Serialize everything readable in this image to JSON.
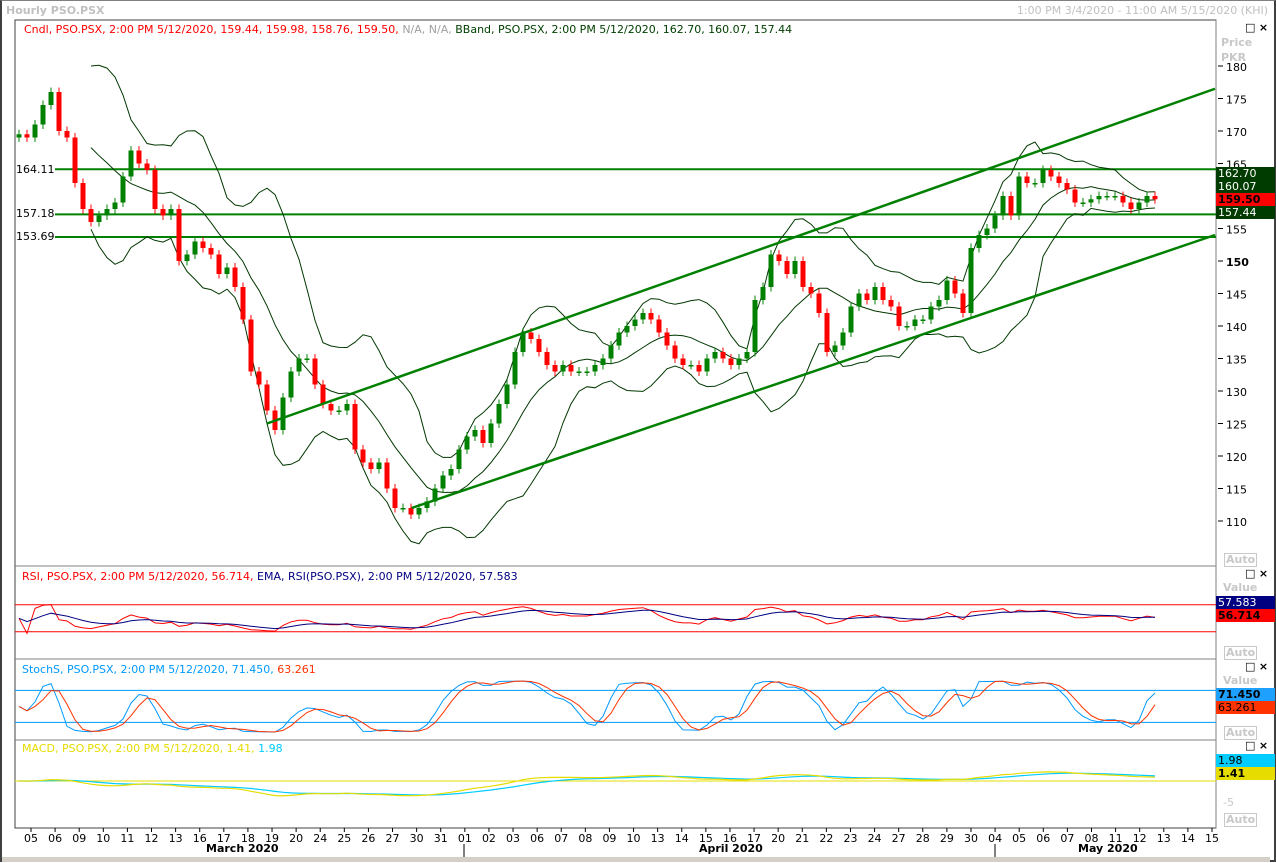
{
  "window": {
    "title": "Hourly PSO.PSX",
    "date_range": "1:00 PM 3/4/2020 - 11:00 AM 5/15/2020 (KHI)",
    "maximize_icon": "maximize-icon",
    "close_icon": "close-icon"
  },
  "main_panel": {
    "legend_candle": "Cndl, PSO.PSX, 2:00 PM 5/12/2020, 159.44, 159.98, 158.76, 159.50,",
    "legend_na": "N/A, N/A,",
    "legend_bband": "BBand, PSO.PSX, 2:00 PM 5/12/2020, 162.70, 160.07, 157.44",
    "axis_title_1": "Price",
    "axis_title_2": "PKR",
    "auto_label": "Auto",
    "value_labels": {
      "bb_upper": "162.70",
      "bb_mid": "160.07",
      "last": "159.50",
      "bb_lower": "157.44"
    },
    "hlines": [
      {
        "label": "164.11",
        "value": 164.11
      },
      {
        "label": "157.18",
        "value": 157.18
      },
      {
        "label": "153.69",
        "value": 153.69
      }
    ]
  },
  "rsi_panel": {
    "legend_rsi": "RSI, PSO.PSX, 2:00 PM 5/12/2020, 56.714,",
    "legend_ema": "EMA, RSI(PSO.PSX), 2:00 PM 5/12/2020, 57.583",
    "axis_title": "Value",
    "auto_label": "Auto",
    "value_labels": {
      "ema": "57.583",
      "rsi": "56.714"
    }
  },
  "stoch_panel": {
    "legend_main": "StochS, PSO.PSX, 2:00 PM 5/12/2020, 71.450,",
    "legend_signal": "63.261",
    "axis_title": "Value",
    "auto_label": "Auto",
    "value_labels": {
      "k": "71.450",
      "d": "63.261"
    }
  },
  "macd_panel": {
    "legend_main": "MACD, PSO.PSX, 2:00 PM 5/12/2020, 1.41,",
    "legend_signal": "1.98",
    "axis_tick": "-5",
    "auto_label": "Auto",
    "value_labels": {
      "signal": "1.98",
      "macd": "1.41"
    }
  },
  "x_axis": {
    "day_labels": [
      "05",
      "06",
      "09",
      "10",
      "11",
      "12",
      "13",
      "16",
      "17",
      "18",
      "19",
      "20",
      "24",
      "25",
      "26",
      "27",
      "30",
      "31",
      "01",
      "02",
      "03",
      "06",
      "07",
      "08",
      "09",
      "10",
      "13",
      "14",
      "15",
      "16",
      "17",
      "20",
      "21",
      "22",
      "23",
      "24",
      "27",
      "28",
      "29",
      "30",
      "04",
      "05",
      "06",
      "07",
      "08",
      "11",
      "12",
      "13",
      "14",
      "15"
    ],
    "months": [
      "March 2020",
      "April 2020",
      "May 2020"
    ]
  },
  "chart_data": {
    "type": "candlestick",
    "symbol": "PSO.PSX",
    "interval": "Hourly",
    "y_axis": {
      "ticks": [
        180,
        175,
        170,
        165,
        160,
        155,
        150,
        145,
        140,
        135,
        130,
        125,
        120,
        115,
        110
      ],
      "ylim": [
        105,
        183
      ]
    },
    "closes": [
      169.5,
      169,
      171,
      174,
      176,
      170,
      169,
      162,
      158,
      156,
      157,
      158,
      159,
      163,
      167,
      165,
      164,
      158,
      157,
      158,
      150,
      151,
      153,
      152,
      151,
      148,
      149,
      146,
      141,
      133,
      131,
      127,
      124,
      129,
      133,
      135,
      135,
      131,
      128,
      127,
      127,
      128,
      121,
      119,
      118,
      119,
      115,
      112,
      112,
      111,
      112,
      113,
      115,
      117,
      118,
      121,
      123,
      124,
      122,
      125,
      128,
      131,
      136,
      139,
      138,
      136,
      134,
      133,
      134,
      133,
      133,
      133,
      134,
      135,
      137,
      139,
      140,
      141,
      142,
      141,
      139,
      137,
      135,
      134,
      134,
      133,
      135,
      136,
      135,
      134,
      135,
      136,
      144,
      146,
      151,
      150,
      148,
      150,
      146,
      145,
      142,
      136,
      137,
      139,
      143,
      145,
      144,
      146,
      144,
      143,
      140,
      140,
      141,
      141,
      143,
      144,
      147,
      145,
      142,
      152,
      154,
      155,
      157,
      160,
      157,
      163,
      162,
      162,
      164,
      163,
      162,
      161,
      159,
      159,
      159.5,
      160,
      160,
      160,
      159,
      158,
      159,
      160,
      159.5
    ],
    "last_bar": {
      "time": "2:00 PM 5/12/2020",
      "open": 159.44,
      "high": 159.98,
      "low": 158.76,
      "close": 159.5
    },
    "bollinger": {
      "upper": 162.7,
      "middle": 160.07,
      "lower": 157.44
    },
    "trendlines": [
      {
        "from": {
          "date": "03/19",
          "price": 125
        },
        "to": {
          "date": "05/15",
          "price": 176.5
        }
      },
      {
        "from": {
          "date": "03/30",
          "price": 112
        },
        "to": {
          "date": "05/15",
          "price": 154
        }
      }
    ],
    "rsi": {
      "value": 56.714,
      "ema": 57.583,
      "levels": [
        70,
        30
      ]
    },
    "stochastic": {
      "k": 71.45,
      "d": 63.261,
      "levels": [
        80,
        20
      ]
    },
    "macd": {
      "macd": 1.41,
      "signal": 1.98
    },
    "colors": {
      "up": "#008000",
      "down": "#ff0000",
      "bband": "#003800",
      "hline": "#008000",
      "rsi": "#ff0000",
      "rsi_ema": "#000080",
      "stoch_k": "#0099ff",
      "stoch_d": "#ff3300",
      "macd": "#e6dc00",
      "macd_signal": "#00ccff"
    }
  }
}
